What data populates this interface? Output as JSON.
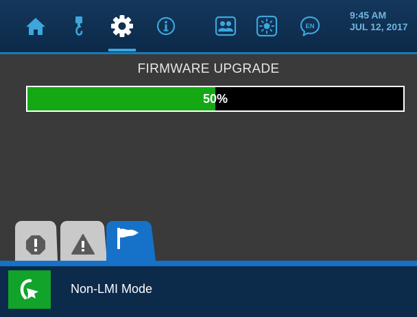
{
  "nav": {
    "items": [
      {
        "name": "home",
        "icon": "home-icon"
      },
      {
        "name": "load-indicator",
        "icon": "hook-icon"
      },
      {
        "name": "settings",
        "icon": "gear-icon",
        "active": true
      },
      {
        "name": "info",
        "icon": "info-icon"
      },
      {
        "name": "users",
        "icon": "users-icon"
      },
      {
        "name": "brightness",
        "icon": "brightness-icon"
      },
      {
        "name": "language",
        "icon": "language-icon",
        "label": "EN"
      }
    ],
    "time": "9:45 AM",
    "date": "JUL 12, 2017"
  },
  "firmware": {
    "title": "FIRMWARE UPGRADE",
    "progress_label": "50%",
    "progress_fraction": 0.5
  },
  "tabs": [
    {
      "name": "stop-alarms",
      "icon": "octagon-exclamation-icon",
      "active": false
    },
    {
      "name": "warnings",
      "icon": "triangle-exclamation-icon",
      "active": false
    },
    {
      "name": "flags",
      "icon": "flag-icon",
      "active": true
    }
  ],
  "mode": {
    "label": "Non-LMI Mode",
    "icon": "bypass-arrow-icon"
  },
  "colors": {
    "topbar": "#0c2a4a",
    "accent_blue": "#137ec0",
    "progress_fill": "#14a814",
    "background": "#3a3a3a",
    "mode_icon_bg": "#11a32a"
  }
}
